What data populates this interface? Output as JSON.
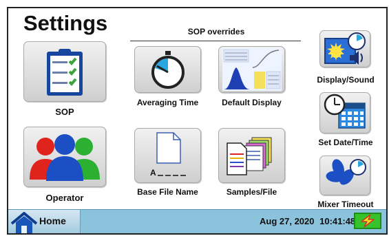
{
  "page": {
    "title": "Settings"
  },
  "sop_overrides": {
    "title": "SOP overrides"
  },
  "buttons": {
    "sop": "SOP",
    "operator": "Operator",
    "averaging_time": "Averaging Time",
    "default_display": "Default Display",
    "base_file_name": "Base File Name",
    "samples_file": "Samples/File",
    "display_sound": "Display/Sound",
    "set_date_time": "Set Date/Time",
    "mixer_timeout": "Mixer Timeout"
  },
  "statusbar": {
    "home": "Home",
    "date": "Aug 27, 2020",
    "time": "10:41:48"
  },
  "icons": {
    "sop": "clipboard-checklist-icon",
    "operator": "users-group-icon",
    "averaging_time": "stopwatch-icon",
    "default_display": "histogram-display-icon",
    "base_file_name": "file-name-icon",
    "samples_file": "stacked-files-icon",
    "display_sound": "display-sound-icon",
    "set_date_time": "clock-calendar-icon",
    "mixer_timeout": "fan-timer-icon",
    "home": "home-icon",
    "power": "power-lightning-icon"
  },
  "colors": {
    "status_bar": "#8cc3dc",
    "power_green": "#36c22b",
    "accent_blue": "#1c4fc4"
  }
}
